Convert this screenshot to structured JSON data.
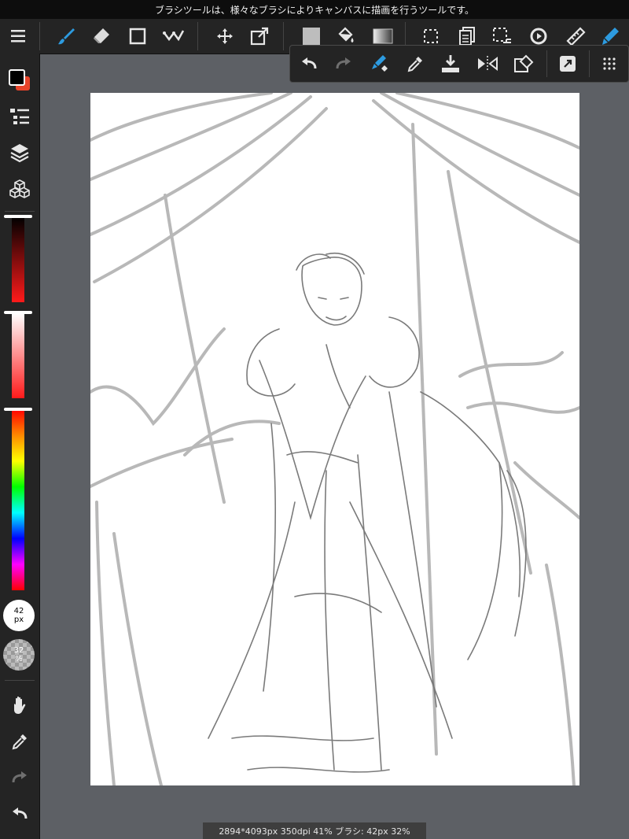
{
  "tooltip": {
    "text": "ブラシツールは、様々なブラシによりキャンバスに描画を行うツールです。"
  },
  "status": {
    "text": "2894*4093px 350dpi 41% ブラシ: 42px 32%"
  },
  "brush": {
    "size_value": "42",
    "size_unit": "px",
    "opacity_value": "32",
    "opacity_unit": "%"
  },
  "colors": {
    "primary": "#000000",
    "secondary": "#e8442a",
    "accent": "#2d9be0"
  },
  "toolbar": {
    "items": [
      "menu-icon",
      "brush-icon",
      "eraser-icon",
      "rectangle-icon",
      "select-tool-icon",
      "move-icon",
      "transform-icon",
      "fill-color-icon",
      "bucket-icon",
      "gradient-icon",
      "selection-icon",
      "copy-layer-icon",
      "deselect-icon",
      "rotate-icon",
      "ruler-icon",
      "pen-icon"
    ]
  },
  "subtoolbar": {
    "items": [
      "undo-icon",
      "redo-icon",
      "brush-snap-icon",
      "eyedropper-icon",
      "save-icon",
      "flip-icon",
      "clear-icon",
      "share-icon",
      "more-icon"
    ]
  },
  "sidebar": {
    "items": [
      "color-swatch",
      "layers-list-icon",
      "layers-icon",
      "material-icon",
      "red-slider",
      "brightness-slider",
      "hue-slider",
      "brush-size",
      "opacity",
      "hand-icon",
      "eyedropper-icon",
      "redo-icon",
      "undo-icon"
    ]
  }
}
